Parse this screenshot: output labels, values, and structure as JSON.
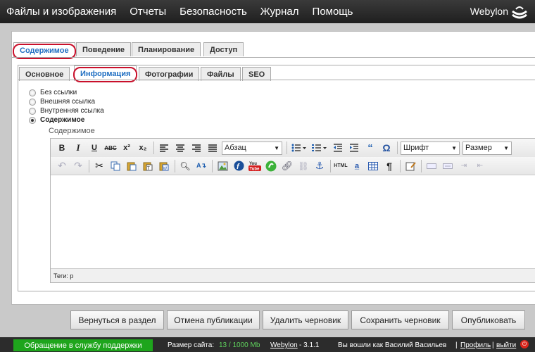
{
  "menu": [
    "Файлы и изображения",
    "Отчеты",
    "Безопасность",
    "Журнал",
    "Помощь"
  ],
  "brand": "Webylon",
  "outer_tabs": [
    "Содержимое",
    "Поведение",
    "Планирование",
    "Доступ"
  ],
  "inner_tabs": [
    "Основное",
    "Информация",
    "Фотографии",
    "Файлы",
    "SEO"
  ],
  "radios": [
    {
      "label": "Без ссылки",
      "checked": false
    },
    {
      "label": "Внешняя ссылка",
      "checked": false
    },
    {
      "label": "Внутренняя ссылка",
      "checked": false
    },
    {
      "label": "Содержимое",
      "checked": true
    }
  ],
  "content_label": "Содержимое",
  "editor": {
    "format_select": "Абзац",
    "font_select": "Шрифт",
    "size_select": "Размер",
    "status": "Теги: p"
  },
  "actions": [
    "Вернуться в раздел",
    "Отмена публикации",
    "Удалить черновик",
    "Сохранить черновик",
    "Опубликовать"
  ],
  "footer": {
    "support": "Обращение в службу поддержки",
    "size_label": "Размер сайта:",
    "size_value": "13 / 1000 Mb",
    "product": "Webylon",
    "version": "- 3.1.1",
    "logged_in": "Вы вошли как Василий Васильев",
    "profile": "Профиль",
    "logout": "выйти"
  },
  "colors": {
    "accent": "#1f6ec2",
    "highlight": "#c9102b",
    "support_green": "#1ea51c"
  }
}
